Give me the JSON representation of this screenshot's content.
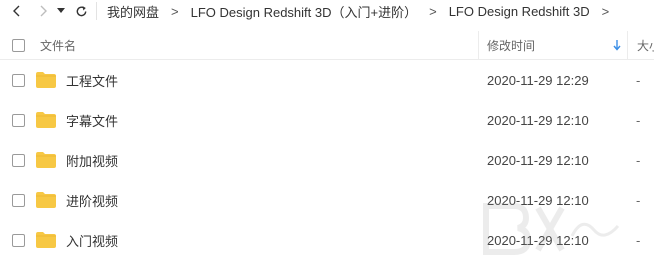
{
  "toolbar": {
    "breadcrumb": [
      "我的网盘",
      "LFO Design Redshift 3D（入门+进阶）",
      "LFO Design Redshift 3D"
    ],
    "breadcrumb_separator": ">"
  },
  "header": {
    "name_label": "文件名",
    "date_label": "修改时间",
    "size_label": "大小"
  },
  "rows": [
    {
      "name": "工程文件",
      "date": "2020-11-29 12:29",
      "size": "-"
    },
    {
      "name": "字幕文件",
      "date": "2020-11-29 12:10",
      "size": "-"
    },
    {
      "name": "附加视频",
      "date": "2020-11-29 12:10",
      "size": "-"
    },
    {
      "name": "进阶视频",
      "date": "2020-11-29 12:10",
      "size": "-"
    },
    {
      "name": "入门视频",
      "date": "2020-11-29 12:10",
      "size": "-"
    }
  ],
  "colors": {
    "folder": "#f7c844",
    "sort_arrow": "#3a8ee6"
  }
}
